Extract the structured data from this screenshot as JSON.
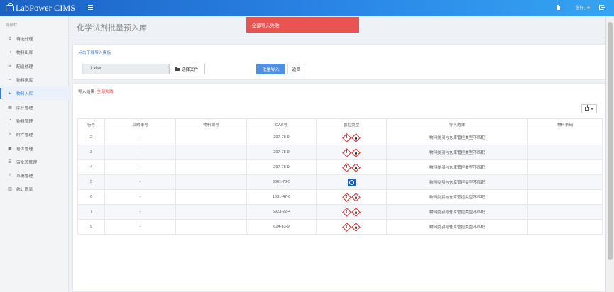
{
  "app": {
    "title": "LabPower CIMS"
  },
  "header": {
    "greeting": "您好, 王"
  },
  "sidebar": {
    "title": "导航栏",
    "items": [
      {
        "label": "待选处理",
        "icon": "gear-icon"
      },
      {
        "label": "物料出库",
        "icon": "export-icon"
      },
      {
        "label": "配送处理",
        "icon": "truck-icon"
      },
      {
        "label": "物料退库",
        "icon": "return-icon"
      },
      {
        "label": "物料入库",
        "icon": "import-icon",
        "active": true
      },
      {
        "label": "库存管理",
        "icon": "inventory-icon"
      },
      {
        "label": "物料管理",
        "icon": "flask-icon"
      },
      {
        "label": "附件管理",
        "icon": "paperclip-icon"
      },
      {
        "label": "仓库管理",
        "icon": "warehouse-icon"
      },
      {
        "label": "审批流管理",
        "icon": "approval-icon"
      },
      {
        "label": "系统管理",
        "icon": "settings-icon"
      },
      {
        "label": "统计图表",
        "icon": "chart-icon"
      }
    ]
  },
  "page": {
    "title": "化学试剂批量预入库"
  },
  "toast": {
    "message": "全部导入失败"
  },
  "upload": {
    "download_link": "点击下载导入模板",
    "file_name": "1.xlsx",
    "choose_label": "选择文件",
    "import_label": "批量导入",
    "back_label": "返回"
  },
  "result": {
    "label": "导入结果:",
    "value": "全部失败"
  },
  "table": {
    "headers": [
      "行号",
      "采购单号",
      "物料编号",
      "CAS号",
      "管控类型",
      "导入结果",
      "物料条码"
    ],
    "rows": [
      {
        "row": "2",
        "po": "-",
        "code": "",
        "cas": "297-78-9",
        "control": "hazard-pair",
        "result": "物料类别与仓库管控类型不匹配",
        "barcode": ""
      },
      {
        "row": "3",
        "po": "-",
        "code": "",
        "cas": "297-78-9",
        "control": "hazard-pair",
        "result": "物料类别与仓库管控类型不匹配",
        "barcode": ""
      },
      {
        "row": "4",
        "po": "-",
        "code": "",
        "cas": "297-78-9",
        "control": "hazard-pair",
        "result": "物料类别与仓库管控类型不匹配",
        "barcode": ""
      },
      {
        "row": "5",
        "po": "-",
        "code": "",
        "cas": "3861-76-5",
        "control": "environment",
        "result": "物料类别与仓库管控类型不匹配",
        "barcode": ""
      },
      {
        "row": "6",
        "po": "-",
        "code": "",
        "cas": "1031-47-6",
        "control": "hazard-pair",
        "result": "物料类别与仓库管控类型不匹配",
        "barcode": ""
      },
      {
        "row": "7",
        "po": "-",
        "code": "",
        "cas": "6923-22-4",
        "control": "hazard-pair",
        "result": "物料类别与仓库管控类型不匹配",
        "barcode": ""
      },
      {
        "row": "9",
        "po": "-",
        "code": "",
        "cas": "624-83-9",
        "control": "hazard-pair",
        "result": "物料类别与仓库管控类型不匹配",
        "barcode": ""
      }
    ]
  },
  "colors": {
    "accent": "#2d7fde",
    "toast_bg": "#e85450",
    "hazard": "#e02020",
    "primary_button": "#4e8fe4"
  }
}
